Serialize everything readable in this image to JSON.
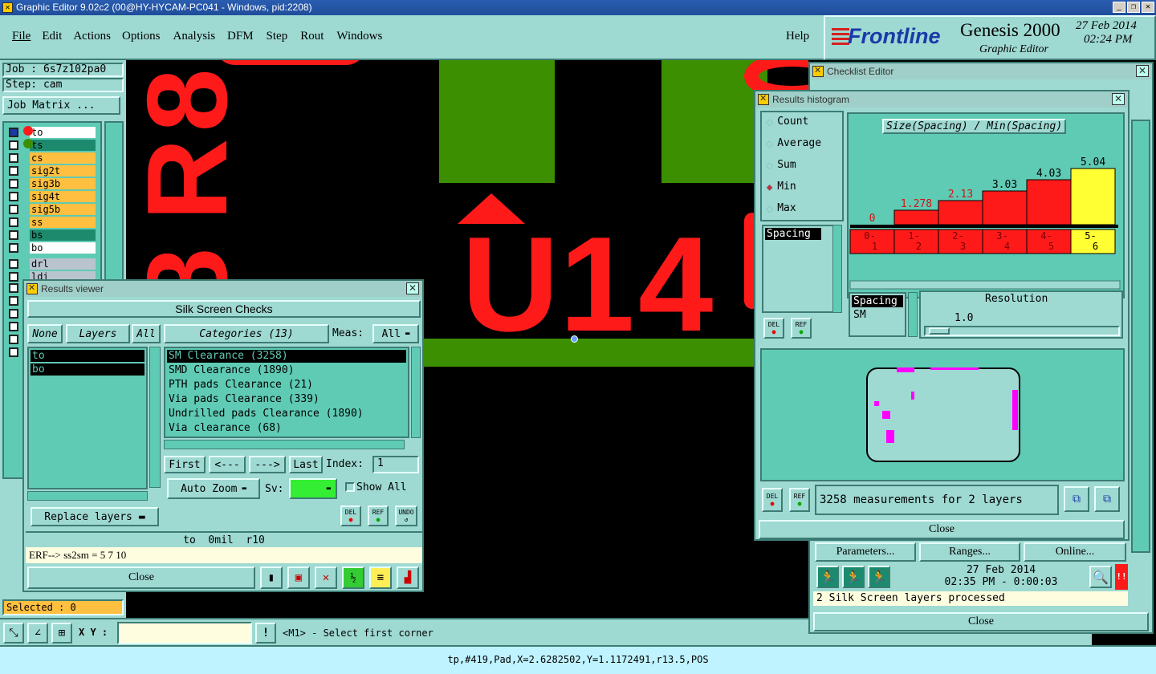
{
  "window": {
    "title": "Graphic Editor 9.02c2 (00@HY-HYCAM-PC041 - Windows, pid:2208)"
  },
  "menu": [
    "File",
    "Edit",
    "Actions",
    "Options",
    "Analysis",
    "DFM",
    "Step",
    "Rout",
    "Windows"
  ],
  "help": "Help",
  "brand": {
    "logo": "Frontline",
    "product": "Genesis 2000",
    "subtitle": "Graphic Editor",
    "date": "27 Feb 2014",
    "time": "02:24 PM"
  },
  "job": {
    "job_label": "Job : 6s7z102pa0",
    "step_label": "Step: cam",
    "matrix_button": "Job Matrix ..."
  },
  "layers": [
    {
      "name": "to",
      "color": "#ffffff"
    },
    {
      "name": "ts",
      "color": "#1d8a6e"
    },
    {
      "name": "cs",
      "color": "#ffbf40"
    },
    {
      "name": "sig2t",
      "color": "#ffbf40"
    },
    {
      "name": "sig3b",
      "color": "#ffbf40"
    },
    {
      "name": "sig4t",
      "color": "#ffbf40"
    },
    {
      "name": "sig5b",
      "color": "#ffbf40"
    },
    {
      "name": "ss",
      "color": "#ffbf40"
    },
    {
      "name": "bs",
      "color": "#1d8a6e"
    },
    {
      "name": "bo",
      "color": "#ffffff"
    },
    {
      "name": "drl",
      "color": "#b9c4cf"
    },
    {
      "name": "ldi",
      "color": "#b9c4cf"
    }
  ],
  "selected": "Selected : 0",
  "canvas": {
    "silk_texts": [
      "5",
      "8",
      "R",
      "8",
      "U",
      "1",
      "4"
    ]
  },
  "results_viewer": {
    "title": "Results viewer",
    "header": "Silk Screen Checks",
    "none_btn": "None",
    "layers_btn": "Layers",
    "all_btn": "All",
    "categories_btn": "Categories (13)",
    "meas_label": "Meas:",
    "meas_value": "All",
    "layer_items": [
      "to",
      "bo"
    ],
    "categories": [
      "SM Clearance (3258)",
      "SMD Clearance (1890)",
      "PTH pads Clearance (21)",
      "Via pads Clearance (339)",
      "Undrilled pads Clearance (1890)",
      "Via clearance (68)"
    ],
    "first": "First",
    "prev": "<---",
    "next": "--->",
    "last": "Last",
    "index_label": "Index:",
    "index_value": "1",
    "auto_zoom": "Auto Zoom",
    "sv_label": "Sv:",
    "show_all": "Show All",
    "replace_layers": "Replace layers",
    "del": "DEL",
    "ref": "REF",
    "undo": "UNDO",
    "info_line": "to  0mil  r10",
    "erf_line": "ERF--> ss2sm = 5 7 10",
    "close": "Close"
  },
  "checklist": {
    "title": "Checklist Editor",
    "params": "Parameters...",
    "ranges": "Ranges...",
    "online": "Online...",
    "date": "27 Feb 2014",
    "time": "02:35 PM - 0:00:03",
    "status": "2 Silk Screen layers processed",
    "close": "Close"
  },
  "histogram": {
    "title": "Results histogram",
    "options": [
      "Count",
      "Average",
      "Sum",
      "Min",
      "Max"
    ],
    "selected_option": "Min",
    "plot_title": "Size(Spacing) / Min(Spacing)",
    "list1": [
      "Spacing"
    ],
    "list2": [
      "Spacing",
      "SM"
    ],
    "resolution_label": "Resolution",
    "resolution_value": "1.0",
    "summary": "3258 measurements for 2 layers",
    "del": "DEL",
    "ref": "REF",
    "close": "Close"
  },
  "chart_data": {
    "type": "bar",
    "title": "Size(Spacing) / Min(Spacing)",
    "categories": [
      "0-1",
      "1-2",
      "2-3",
      "3-4",
      "4-5",
      "5-6"
    ],
    "category_labels": [
      [
        "0-",
        "1"
      ],
      [
        "1-",
        "2"
      ],
      [
        "2-",
        "3"
      ],
      [
        "3-",
        "4"
      ],
      [
        "4-",
        "5"
      ],
      [
        "5-",
        "6"
      ]
    ],
    "values": [
      0,
      1.278,
      2.13,
      3.03,
      4.03,
      5.04
    ],
    "value_labels": [
      "0",
      "1.278",
      "2.13",
      "3.03",
      "4.03",
      "5.04"
    ],
    "highlight_index": 5,
    "bar_color": "#ff1a1a",
    "highlight_color": "#ffff33",
    "ylim": [
      0,
      5.04
    ]
  },
  "bottom": {
    "xy_label": "X Y :",
    "prompt": "<M1> - Select first corner",
    "status": "tp,#419,Pad,X=2.6282502,Y=1.1172491,r13.5,POS"
  }
}
